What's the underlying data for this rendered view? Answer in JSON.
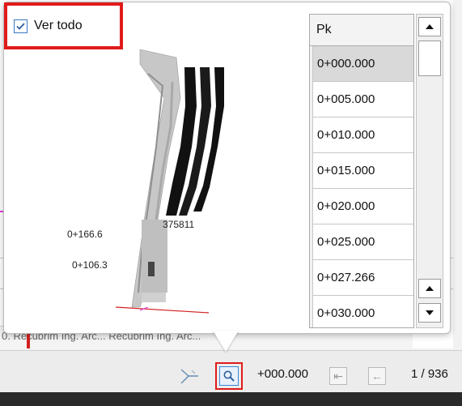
{
  "popup": {
    "ver_todo_label": "Ver todo",
    "ver_todo_checked": true,
    "preview_labels": {
      "station_a": "0+166.6",
      "station_b": "0+106.3",
      "station_c": "375811"
    }
  },
  "pk_table": {
    "header": "Pk",
    "rows": [
      "0+000.000",
      "0+005.000",
      "0+010.000",
      "0+015.000",
      "0+020.000",
      "0+025.000",
      "0+027.266",
      "0+030.000"
    ],
    "selected_index": 0
  },
  "statusbar": {
    "pk_value": "+000.000",
    "count": "1 / 936"
  },
  "background": {
    "strip_text": "0.    Recubrim Ing. Arc...    Recubrim Ing. Arc..."
  },
  "colors": {
    "highlight_red": "#e01b1b",
    "accent_blue": "#3b86d6",
    "magenta": "#e23fe2"
  },
  "icons": [
    "checkbox-check-icon",
    "zoom-icon",
    "axis-icon",
    "first-page-icon",
    "previous-icon",
    "scroll-up-icon",
    "scroll-down-icon"
  ]
}
